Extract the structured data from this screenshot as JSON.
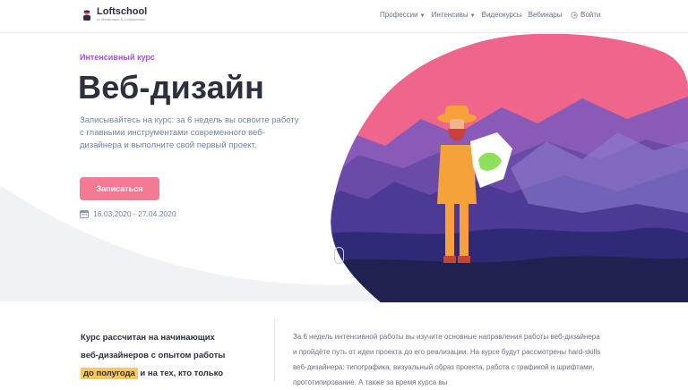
{
  "header": {
    "logo_name": "Loftschool",
    "logo_sub": "от Мегаплана & Софтконтакт",
    "nav": [
      {
        "label": "Профессии",
        "dropdown": true
      },
      {
        "label": "Интенсивы",
        "dropdown": true
      },
      {
        "label": "Видеокурсы",
        "dropdown": false
      },
      {
        "label": "Вебинары",
        "dropdown": false
      }
    ],
    "login_label": "Войти"
  },
  "hero": {
    "eyebrow": "Интенсивный курс",
    "title": "Веб-дизайн",
    "description": "Записывайтесь на курс: за 6 недель вы освоите работу с главными инструментами современного веб-дизайнера и выполните свой первый проект.",
    "cta_label": "Записаться",
    "dates": "16.03.2020 - 27.04.2020"
  },
  "audience": {
    "line1": "Курс рассчитан на начинающих",
    "line2": "веб-дизайнеров с опытом работы",
    "highlight": "до полугода",
    "line3_rest": " и на тех, кто только"
  },
  "about": {
    "text": "За 6 недель интенсивной работы вы изучите основные направления работы веб-дизайнера и пройдёте путь от идеи проекта до его реализации. На курсе будут рассмотрены hard-skills веб-дизайнера: типографика, визуальный образ проекта, работа с графикой и шрифтами, прототипирование. А также за время курса вы"
  },
  "colors": {
    "accent_purple": "#a74fe0",
    "cta_pink": "#f47a94",
    "highlight_yellow": "#fbc85c",
    "sky_pink": "#f0658a",
    "mountain_purple": "#6a4ca8",
    "dark_navy": "#1f2150"
  }
}
